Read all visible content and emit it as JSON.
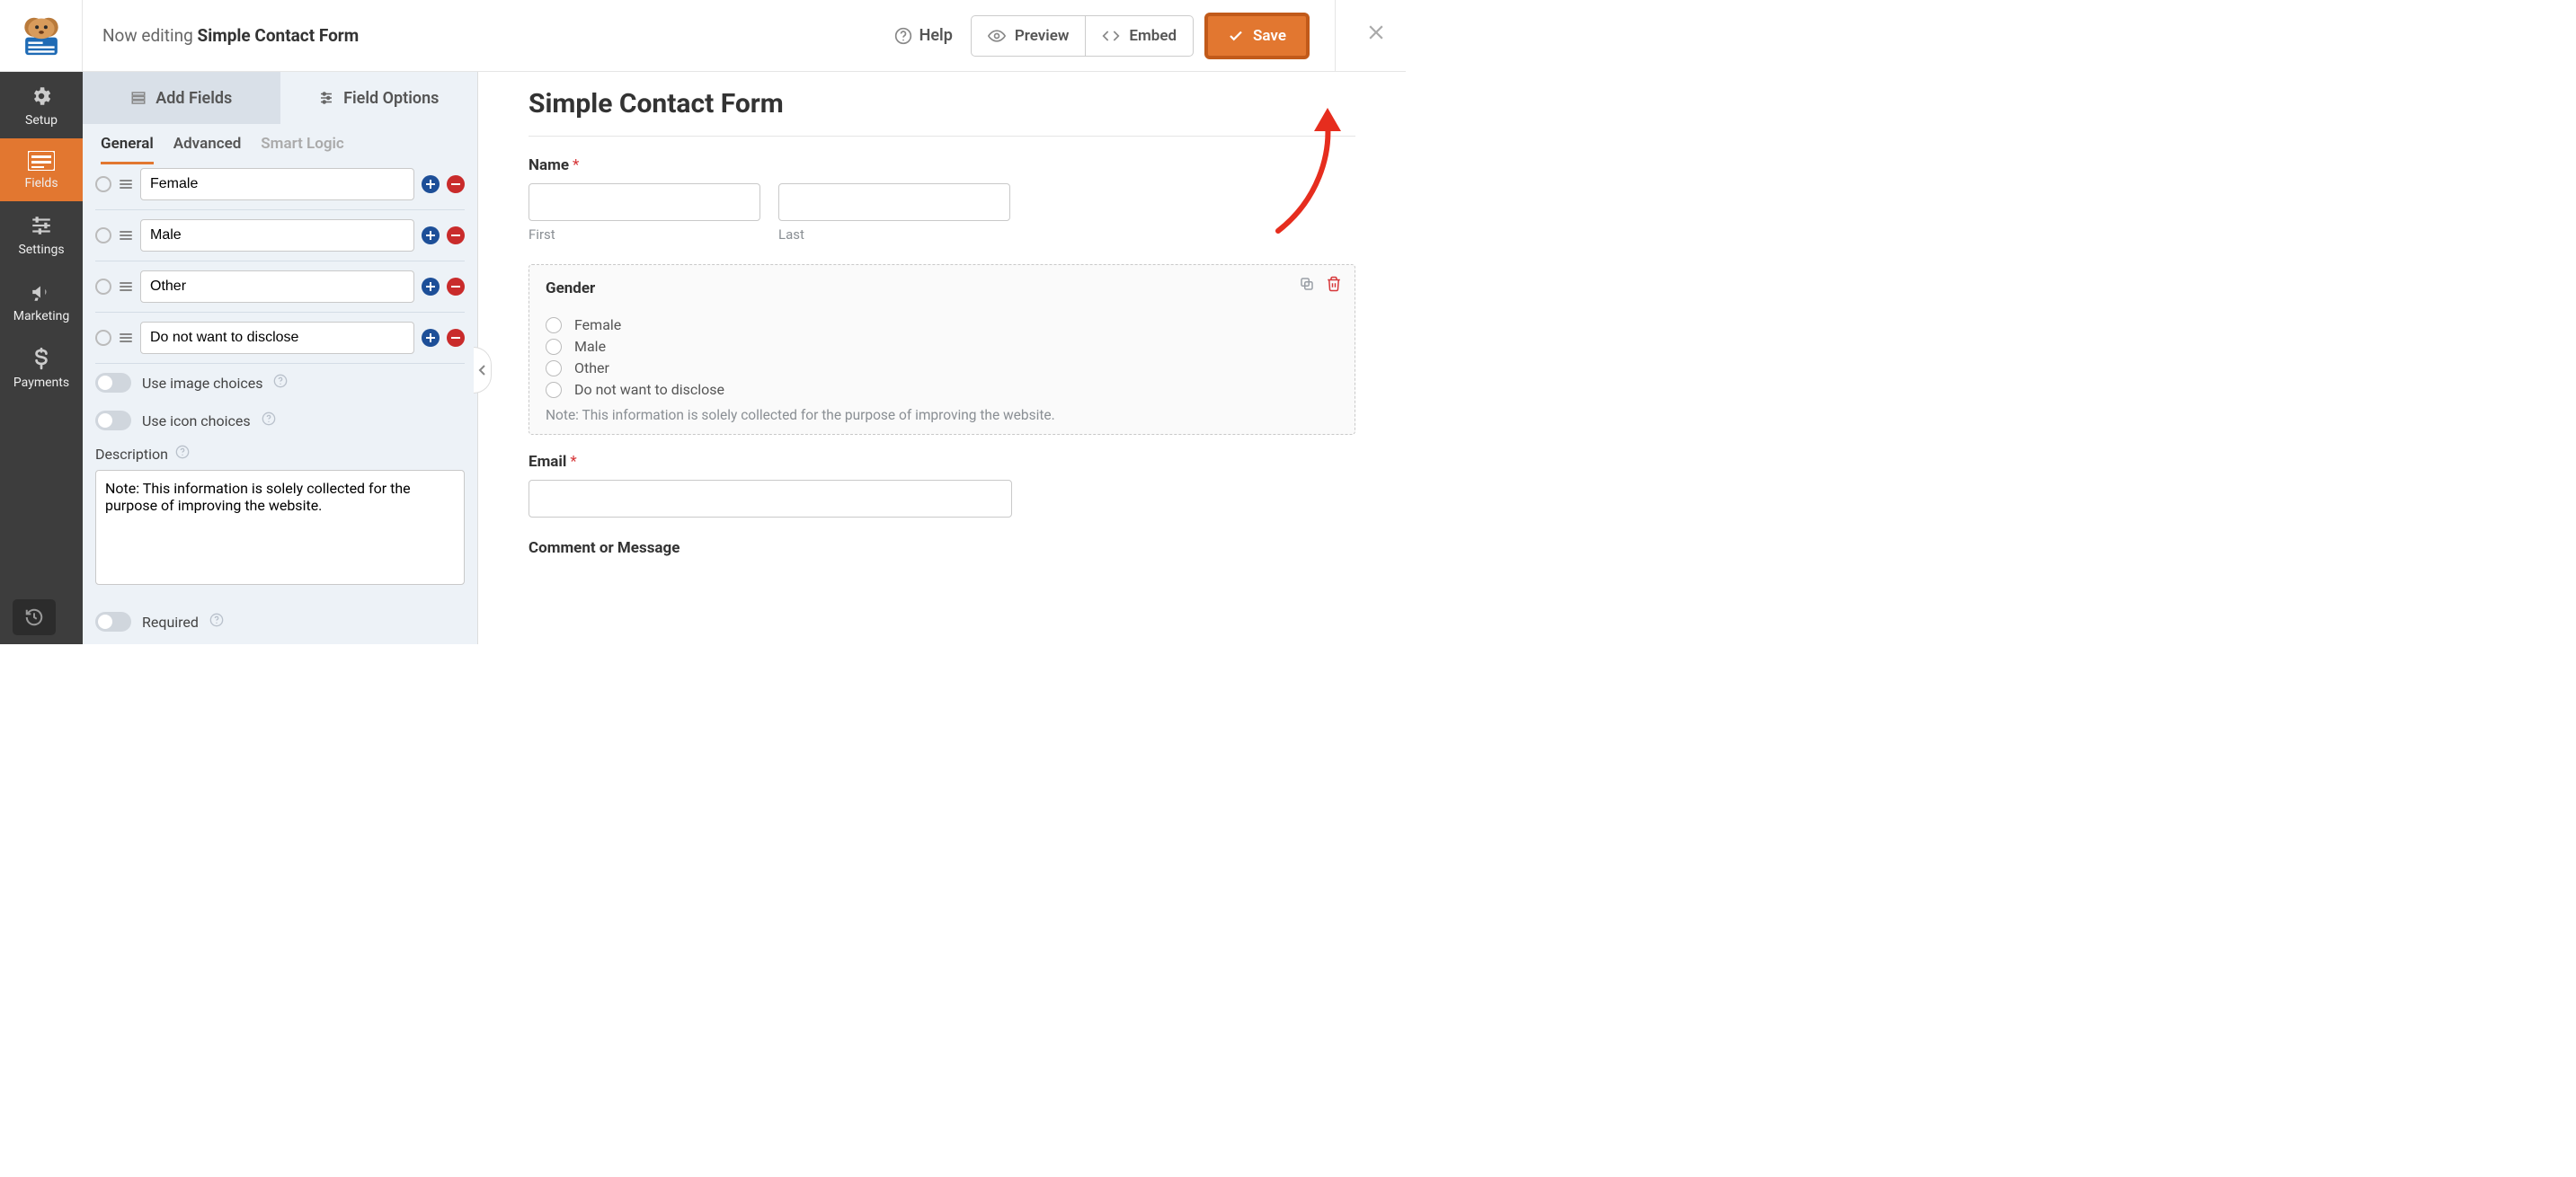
{
  "topbar": {
    "now_editing_prefix": "Now editing ",
    "form_name": "Simple Contact Form",
    "help": "Help",
    "preview": "Preview",
    "embed": "Embed",
    "save": "Save"
  },
  "leftnav": {
    "setup": "Setup",
    "fields": "Fields",
    "settings": "Settings",
    "marketing": "Marketing",
    "payments": "Payments"
  },
  "panel": {
    "tabs": {
      "add": "Add Fields",
      "options": "Field Options"
    },
    "subtabs": {
      "general": "General",
      "advanced": "Advanced",
      "smart": "Smart Logic"
    },
    "choices": [
      "Female",
      "Male",
      "Other",
      "Do not want to disclose"
    ],
    "toggles": {
      "image": "Use image choices",
      "icon": "Use icon choices",
      "required": "Required"
    },
    "description_label": "Description",
    "description_value": "Note: This information is solely collected for the purpose of improving the website."
  },
  "preview": {
    "title": "Simple Contact Form",
    "name_label": "Name",
    "first": "First",
    "last": "Last",
    "gender_label": "Gender",
    "gender_options": [
      "Female",
      "Male",
      "Other",
      "Do not want to disclose"
    ],
    "gender_note": "Note: This information is solely collected for the purpose of improving the website.",
    "email_label": "Email",
    "comment_label": "Comment or Message"
  }
}
